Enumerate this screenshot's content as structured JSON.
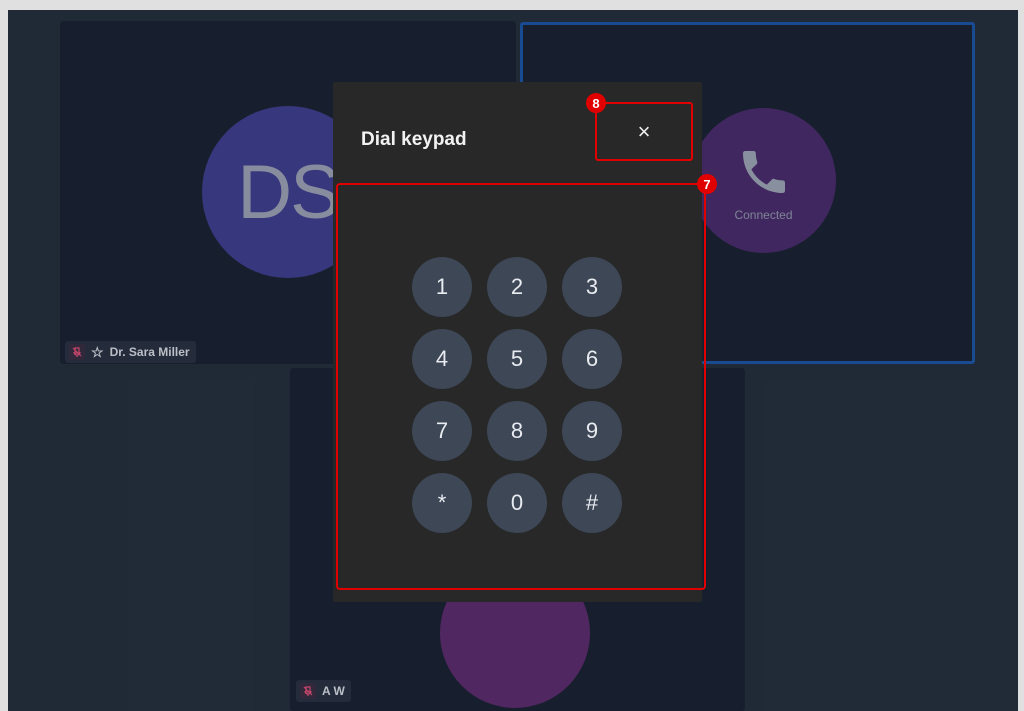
{
  "participants": {
    "ds": {
      "initials": "DS",
      "name": "Dr. Sara Miller"
    },
    "call": {
      "status": "Connected"
    },
    "aw": {
      "name": "A W"
    }
  },
  "modal": {
    "title": "Dial keypad",
    "close_label": "×",
    "keys": [
      "1",
      "2",
      "3",
      "4",
      "5",
      "6",
      "7",
      "8",
      "9",
      "*",
      "0",
      "#"
    ]
  },
  "annotations": {
    "close_badge": "8",
    "keypad_badge": "7"
  },
  "colors": {
    "stage": "#25303f",
    "tile": "#1b2435",
    "active_border": "#1d56a8",
    "modal": "#282828",
    "key": "#3d4756",
    "highlight": "#e00000"
  }
}
